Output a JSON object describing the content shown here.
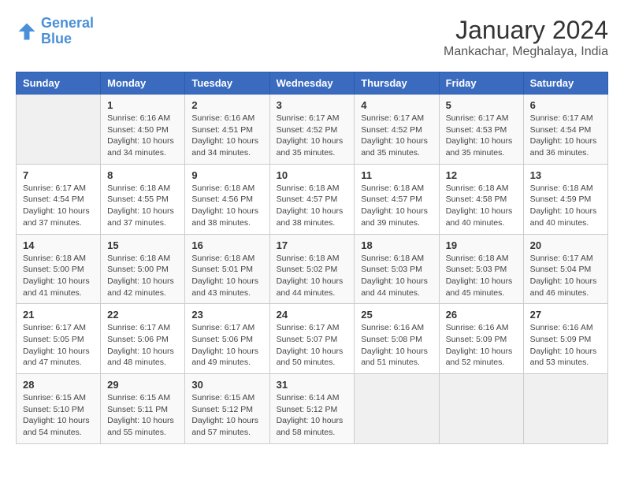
{
  "header": {
    "logo_line1": "General",
    "logo_line2": "Blue",
    "title": "January 2024",
    "subtitle": "Mankachar, Meghalaya, India"
  },
  "days_of_week": [
    "Sunday",
    "Monday",
    "Tuesday",
    "Wednesday",
    "Thursday",
    "Friday",
    "Saturday"
  ],
  "weeks": [
    [
      {
        "day": "",
        "info": ""
      },
      {
        "day": "1",
        "info": "Sunrise: 6:16 AM\nSunset: 4:50 PM\nDaylight: 10 hours\nand 34 minutes."
      },
      {
        "day": "2",
        "info": "Sunrise: 6:16 AM\nSunset: 4:51 PM\nDaylight: 10 hours\nand 34 minutes."
      },
      {
        "day": "3",
        "info": "Sunrise: 6:17 AM\nSunset: 4:52 PM\nDaylight: 10 hours\nand 35 minutes."
      },
      {
        "day": "4",
        "info": "Sunrise: 6:17 AM\nSunset: 4:52 PM\nDaylight: 10 hours\nand 35 minutes."
      },
      {
        "day": "5",
        "info": "Sunrise: 6:17 AM\nSunset: 4:53 PM\nDaylight: 10 hours\nand 35 minutes."
      },
      {
        "day": "6",
        "info": "Sunrise: 6:17 AM\nSunset: 4:54 PM\nDaylight: 10 hours\nand 36 minutes."
      }
    ],
    [
      {
        "day": "7",
        "info": "Sunrise: 6:17 AM\nSunset: 4:54 PM\nDaylight: 10 hours\nand 37 minutes."
      },
      {
        "day": "8",
        "info": "Sunrise: 6:18 AM\nSunset: 4:55 PM\nDaylight: 10 hours\nand 37 minutes."
      },
      {
        "day": "9",
        "info": "Sunrise: 6:18 AM\nSunset: 4:56 PM\nDaylight: 10 hours\nand 38 minutes."
      },
      {
        "day": "10",
        "info": "Sunrise: 6:18 AM\nSunset: 4:57 PM\nDaylight: 10 hours\nand 38 minutes."
      },
      {
        "day": "11",
        "info": "Sunrise: 6:18 AM\nSunset: 4:57 PM\nDaylight: 10 hours\nand 39 minutes."
      },
      {
        "day": "12",
        "info": "Sunrise: 6:18 AM\nSunset: 4:58 PM\nDaylight: 10 hours\nand 40 minutes."
      },
      {
        "day": "13",
        "info": "Sunrise: 6:18 AM\nSunset: 4:59 PM\nDaylight: 10 hours\nand 40 minutes."
      }
    ],
    [
      {
        "day": "14",
        "info": "Sunrise: 6:18 AM\nSunset: 5:00 PM\nDaylight: 10 hours\nand 41 minutes."
      },
      {
        "day": "15",
        "info": "Sunrise: 6:18 AM\nSunset: 5:00 PM\nDaylight: 10 hours\nand 42 minutes."
      },
      {
        "day": "16",
        "info": "Sunrise: 6:18 AM\nSunset: 5:01 PM\nDaylight: 10 hours\nand 43 minutes."
      },
      {
        "day": "17",
        "info": "Sunrise: 6:18 AM\nSunset: 5:02 PM\nDaylight: 10 hours\nand 44 minutes."
      },
      {
        "day": "18",
        "info": "Sunrise: 6:18 AM\nSunset: 5:03 PM\nDaylight: 10 hours\nand 44 minutes."
      },
      {
        "day": "19",
        "info": "Sunrise: 6:18 AM\nSunset: 5:03 PM\nDaylight: 10 hours\nand 45 minutes."
      },
      {
        "day": "20",
        "info": "Sunrise: 6:17 AM\nSunset: 5:04 PM\nDaylight: 10 hours\nand 46 minutes."
      }
    ],
    [
      {
        "day": "21",
        "info": "Sunrise: 6:17 AM\nSunset: 5:05 PM\nDaylight: 10 hours\nand 47 minutes."
      },
      {
        "day": "22",
        "info": "Sunrise: 6:17 AM\nSunset: 5:06 PM\nDaylight: 10 hours\nand 48 minutes."
      },
      {
        "day": "23",
        "info": "Sunrise: 6:17 AM\nSunset: 5:06 PM\nDaylight: 10 hours\nand 49 minutes."
      },
      {
        "day": "24",
        "info": "Sunrise: 6:17 AM\nSunset: 5:07 PM\nDaylight: 10 hours\nand 50 minutes."
      },
      {
        "day": "25",
        "info": "Sunrise: 6:16 AM\nSunset: 5:08 PM\nDaylight: 10 hours\nand 51 minutes."
      },
      {
        "day": "26",
        "info": "Sunrise: 6:16 AM\nSunset: 5:09 PM\nDaylight: 10 hours\nand 52 minutes."
      },
      {
        "day": "27",
        "info": "Sunrise: 6:16 AM\nSunset: 5:09 PM\nDaylight: 10 hours\nand 53 minutes."
      }
    ],
    [
      {
        "day": "28",
        "info": "Sunrise: 6:15 AM\nSunset: 5:10 PM\nDaylight: 10 hours\nand 54 minutes."
      },
      {
        "day": "29",
        "info": "Sunrise: 6:15 AM\nSunset: 5:11 PM\nDaylight: 10 hours\nand 55 minutes."
      },
      {
        "day": "30",
        "info": "Sunrise: 6:15 AM\nSunset: 5:12 PM\nDaylight: 10 hours\nand 57 minutes."
      },
      {
        "day": "31",
        "info": "Sunrise: 6:14 AM\nSunset: 5:12 PM\nDaylight: 10 hours\nand 58 minutes."
      },
      {
        "day": "",
        "info": ""
      },
      {
        "day": "",
        "info": ""
      },
      {
        "day": "",
        "info": ""
      }
    ]
  ]
}
